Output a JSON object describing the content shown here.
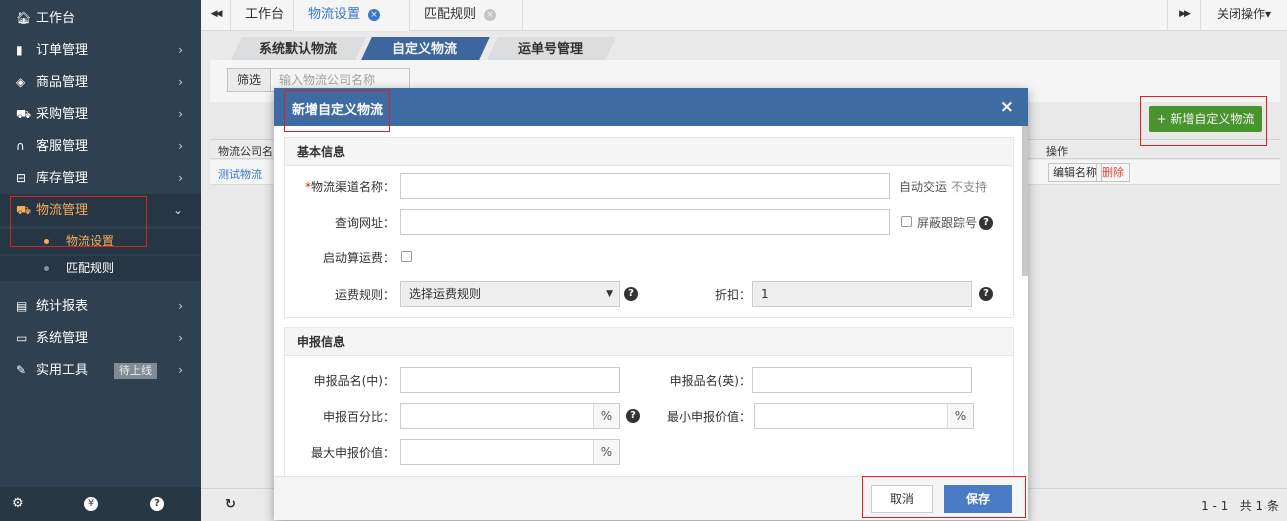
{
  "sidebar": {
    "items": [
      {
        "icon": "home-icon",
        "glyph": "🏠︎",
        "label": "工作台",
        "chevron": ""
      },
      {
        "icon": "clipboard-icon",
        "glyph": "▮",
        "label": "订单管理",
        "chevron": "›"
      },
      {
        "icon": "cube-icon",
        "glyph": "◈",
        "label": "商品管理",
        "chevron": "›"
      },
      {
        "icon": "cart-icon",
        "glyph": "⛟",
        "label": "采购管理",
        "chevron": "›"
      },
      {
        "icon": "headset-icon",
        "glyph": "∩",
        "label": "客服管理",
        "chevron": "›"
      },
      {
        "icon": "inbox-icon",
        "glyph": "⊟",
        "label": "库存管理",
        "chevron": "›"
      },
      {
        "icon": "truck-icon",
        "glyph": "⛟",
        "label": "物流管理",
        "chevron": "⌄"
      },
      {
        "icon": "report-icon",
        "glyph": "▤",
        "label": "统计报表",
        "chevron": "›"
      },
      {
        "icon": "monitor-icon",
        "glyph": "▭",
        "label": "系统管理",
        "chevron": "›"
      },
      {
        "icon": "wrench-icon",
        "glyph": "✎",
        "label": "实用工具",
        "chevron": "›",
        "badge": "待上线"
      }
    ],
    "subitems": [
      {
        "label": "物流设置",
        "active": true
      },
      {
        "label": "匹配规则",
        "active": false
      }
    ],
    "footer": {
      "settings": "⚙",
      "yen": "¥",
      "help": "?"
    }
  },
  "tabs": {
    "back": "◀◀",
    "items": [
      {
        "label": "工作台"
      },
      {
        "label": "物流设置",
        "close": "×"
      },
      {
        "label": "匹配规则",
        "close": "×"
      }
    ],
    "forward": "▶▶",
    "close_ops": "关闭操作▾"
  },
  "subtabs": [
    "系统默认物流",
    "自定义物流",
    "运单号管理"
  ],
  "filter": {
    "label": "筛选",
    "placeholder": "输入物流公司名称"
  },
  "add_button": "+ 新增自定义物流",
  "table": {
    "col_company": "物流公司名",
    "col_ops": "操作",
    "row_company": "测试物流",
    "edit": "编辑名称",
    "delete": "删除"
  },
  "footer": {
    "refresh": "↻",
    "pagination": "1 - 1   共 1 条"
  },
  "modal": {
    "title": "新增自定义物流",
    "close": "×",
    "basic": {
      "title": "基本信息",
      "required_mark": "*",
      "channel_label": "物流渠道名称：",
      "channel_value": "",
      "auto_deliver": "自动交运",
      "not_supported": "不支持",
      "query_label": "查询网址：",
      "query_value": "",
      "hide_tracking": "屏蔽跟踪号",
      "calc_label": "启动算运费：",
      "rule_label": "运费规则：",
      "rule_value": "选择运费规则",
      "discount_label": "折扣：",
      "discount_value": "1"
    },
    "declare": {
      "title": "申报信息",
      "name_cn_label": "申报品名(中)：",
      "name_en_label": "申报品名(英)：",
      "percent_label": "申报百分比：",
      "min_label": "最小申报价值：",
      "max_label": "最大申报价值：",
      "unit": "%"
    },
    "cancel": "取消",
    "save": "保存"
  },
  "colors": {
    "sidebar": "#2f4050",
    "active": "#f8ac59",
    "modal_header": "#3f6ba3",
    "save": "#4a7cc6",
    "add": "#4d9b2f",
    "highlight": "#e02020"
  }
}
